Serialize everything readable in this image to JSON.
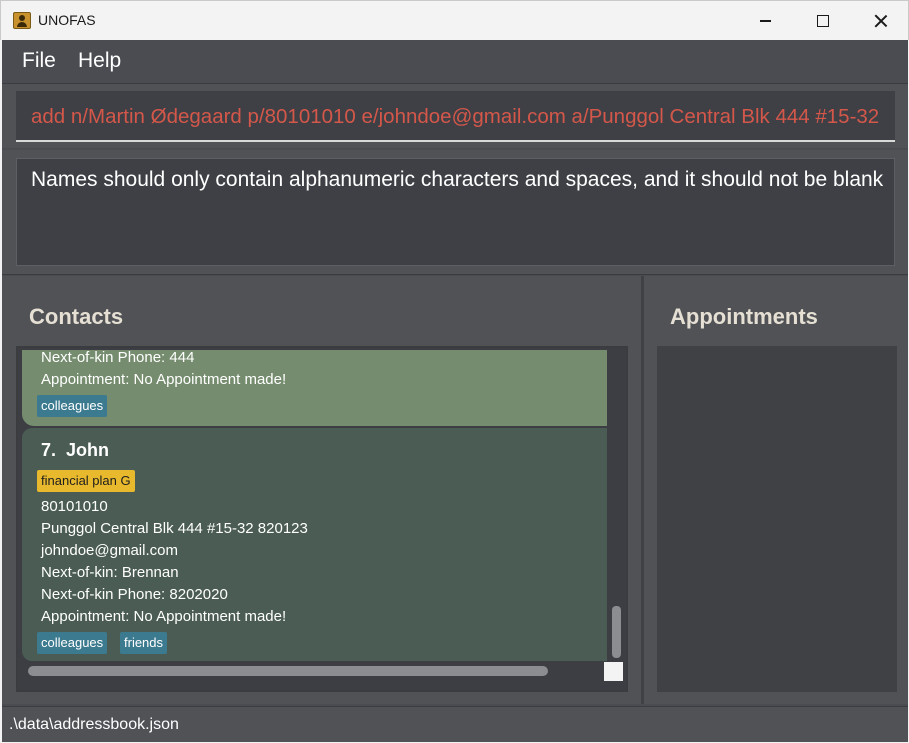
{
  "window": {
    "title": "UNOFAS",
    "icon": "app-icon",
    "controls": [
      "minimize-icon",
      "maximize-icon",
      "close-icon"
    ]
  },
  "menu": {
    "file": "File",
    "help": "Help"
  },
  "command": {
    "value": "add n/Martin Ødegaard p/80101010 e/johndoe@gmail.com a/Punggol Central Blk 444 #15-32",
    "color": "#d4574a"
  },
  "result": {
    "message": "Names should only contain alphanumeric characters and spaces, and it should not be blank"
  },
  "contacts": {
    "title": "Contacts",
    "cards": [
      {
        "lines": [
          "Next-of-kin Phone: 444",
          "Appointment: No Appointment made!"
        ],
        "tags": [
          "colleagues"
        ],
        "color": "#758d6e"
      },
      {
        "index": "7.",
        "name": "John",
        "plan": "financial plan G",
        "lines": [
          "80101010",
          "Punggol Central Blk 444 #15-32 820123",
          "johndoe@gmail.com",
          "Next-of-kin: Brennan",
          "Next-of-kin Phone: 8202020",
          "Appointment: No Appointment made!"
        ],
        "tags": [
          "colleagues",
          "friends"
        ],
        "color": "#4a5c53"
      }
    ]
  },
  "appointments": {
    "title": "Appointments"
  },
  "status": {
    "path": ".\\data\\addressbook.json"
  },
  "colors": {
    "background": "#4a4c51",
    "tag": "#3c7b8f",
    "plan_tag": "#e8b92c"
  }
}
